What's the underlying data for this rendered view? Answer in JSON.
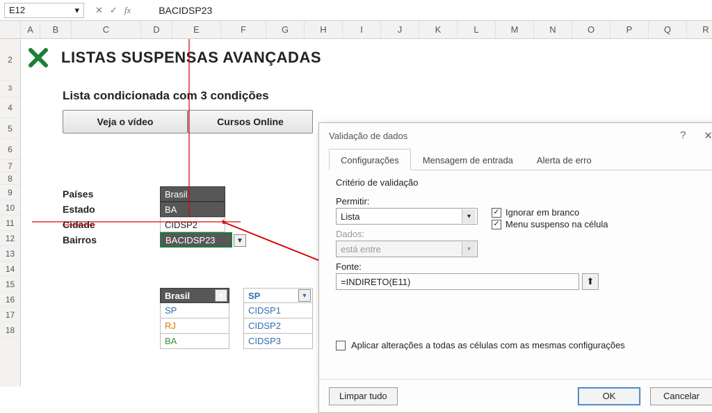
{
  "formula_bar": {
    "cell_ref": "E12",
    "value": "BACIDSP23"
  },
  "columns": [
    "",
    "A",
    "B",
    "C",
    "D",
    "E",
    "F",
    "G",
    "H",
    "I",
    "J",
    "K",
    "L",
    "M",
    "N",
    "O",
    "P",
    "Q",
    "R"
  ],
  "rows": [
    "2",
    "3",
    "4",
    "5",
    "6",
    "7",
    "8",
    "9",
    "10",
    "11",
    "12",
    "13",
    "14",
    "15",
    "16",
    "17",
    "18"
  ],
  "header": {
    "title": "LISTAS SUSPENSAS AVANÇADAS",
    "subtitle": "Lista condicionada com 3 condições"
  },
  "buttons": {
    "video": "Veja o vídeo",
    "cursos": "Cursos Online"
  },
  "labels": {
    "paises": "Países",
    "estado": "Estado",
    "cidade": "Cidade",
    "bairros": "Bairros"
  },
  "values": {
    "paises": "Brasil",
    "estado": "BA",
    "cidade": "CIDSP2",
    "bairros": "BACIDSP23"
  },
  "table1": {
    "head": "Brasil",
    "r1": "SP",
    "r2": "RJ",
    "r3": "BA"
  },
  "table2": {
    "head": "SP",
    "r1": "CIDSP1",
    "r2": "CIDSP2",
    "r3": "CIDSP3"
  },
  "dialog": {
    "title": "Validação de dados",
    "tabs": {
      "t1": "Configurações",
      "t2": "Mensagem de entrada",
      "t3": "Alerta de erro"
    },
    "group": "Critério de validação",
    "permitir_lbl": "Permitir:",
    "permitir_val": "Lista",
    "dados_lbl": "Dados:",
    "dados_val": "está entre",
    "chk1": "Ignorar em branco",
    "chk2": "Menu suspenso na célula",
    "fonte_lbl": "Fonte:",
    "fonte_val": "=INDIRETO(E11)",
    "apply_all": "Aplicar alterações a todas as células com as mesmas configurações",
    "clear": "Limpar tudo",
    "ok": "OK",
    "cancel": "Cancelar"
  }
}
